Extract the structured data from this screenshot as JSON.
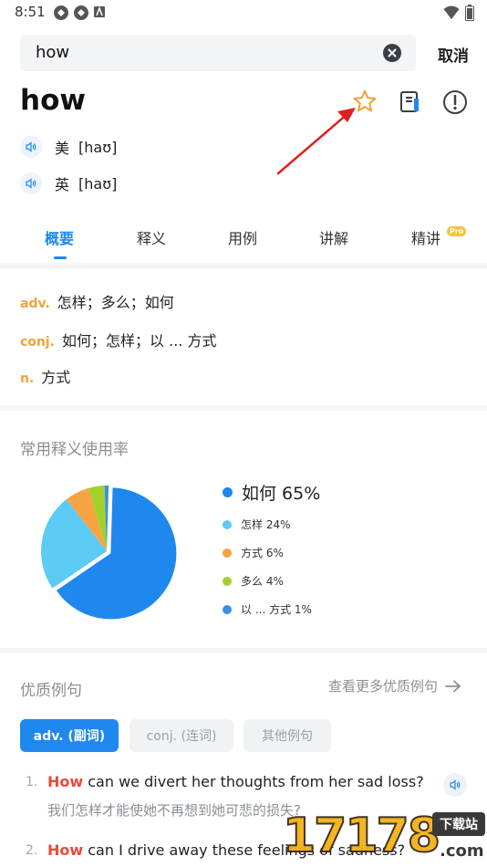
{
  "status_bar": {
    "time": "8:51"
  },
  "search": {
    "value": "how",
    "cancel_label": "取消"
  },
  "word": {
    "title": "how",
    "pronunciations": [
      {
        "region": "美",
        "ipa": "[haʊ]"
      },
      {
        "region": "英",
        "ipa": "[haʊ]"
      }
    ]
  },
  "tabs": [
    {
      "label": "概要",
      "active": true
    },
    {
      "label": "释义",
      "active": false
    },
    {
      "label": "用例",
      "active": false
    },
    {
      "label": "讲解",
      "active": false
    },
    {
      "label": "精讲",
      "active": false,
      "badge": "Pro"
    }
  ],
  "definitions": [
    {
      "pos": "adv.",
      "text": "怎样；多么；如何"
    },
    {
      "pos": "conj.",
      "text": "如何；怎样；以 ... 方式"
    },
    {
      "pos": "n.",
      "text": "方式"
    }
  ],
  "usage_section": {
    "title": "常用释义使用率"
  },
  "chart_data": {
    "type": "pie",
    "title": "常用释义使用率",
    "series": [
      {
        "name": "如何 65%",
        "label": "如何",
        "value": 65,
        "color": "#1f88ee"
      },
      {
        "name": "怎样 24%",
        "label": "怎样",
        "value": 24,
        "color": "#5ccbf5"
      },
      {
        "name": "方式 6%",
        "label": "方式",
        "value": 6,
        "color": "#f7a343"
      },
      {
        "name": "多么 4%",
        "label": "多么",
        "value": 4,
        "color": "#a3d12b"
      },
      {
        "name": "以 ... 方式 1%",
        "label": "以 ... 方式",
        "value": 1,
        "color": "#3a8fe6"
      }
    ],
    "legend_position": "right"
  },
  "examples_section": {
    "title": "优质例句",
    "more_label": "查看更多优质例句",
    "chips": [
      {
        "label": "adv. (副词)",
        "active": true
      },
      {
        "label": "conj. (连词)",
        "active": false
      },
      {
        "label": "其他例句",
        "active": false
      }
    ],
    "items": [
      {
        "num": "1.",
        "keyword": "How",
        "rest": " can we divert her thoughts from her sad loss?",
        "zh": "我们怎样才能使她不再想到她可悲的损失?"
      },
      {
        "num": "2.",
        "keyword": "How",
        "rest": " can I drive away these feelings of sadness?",
        "zh": ""
      }
    ]
  },
  "watermark": {
    "digits": "17178",
    "tag": "下载站",
    "domain": ".com"
  },
  "colors": {
    "accent": "#1f88ee",
    "pos_orange": "#f0a33a",
    "keyword_red": "#e84a3c",
    "star": "#f0a33a"
  }
}
